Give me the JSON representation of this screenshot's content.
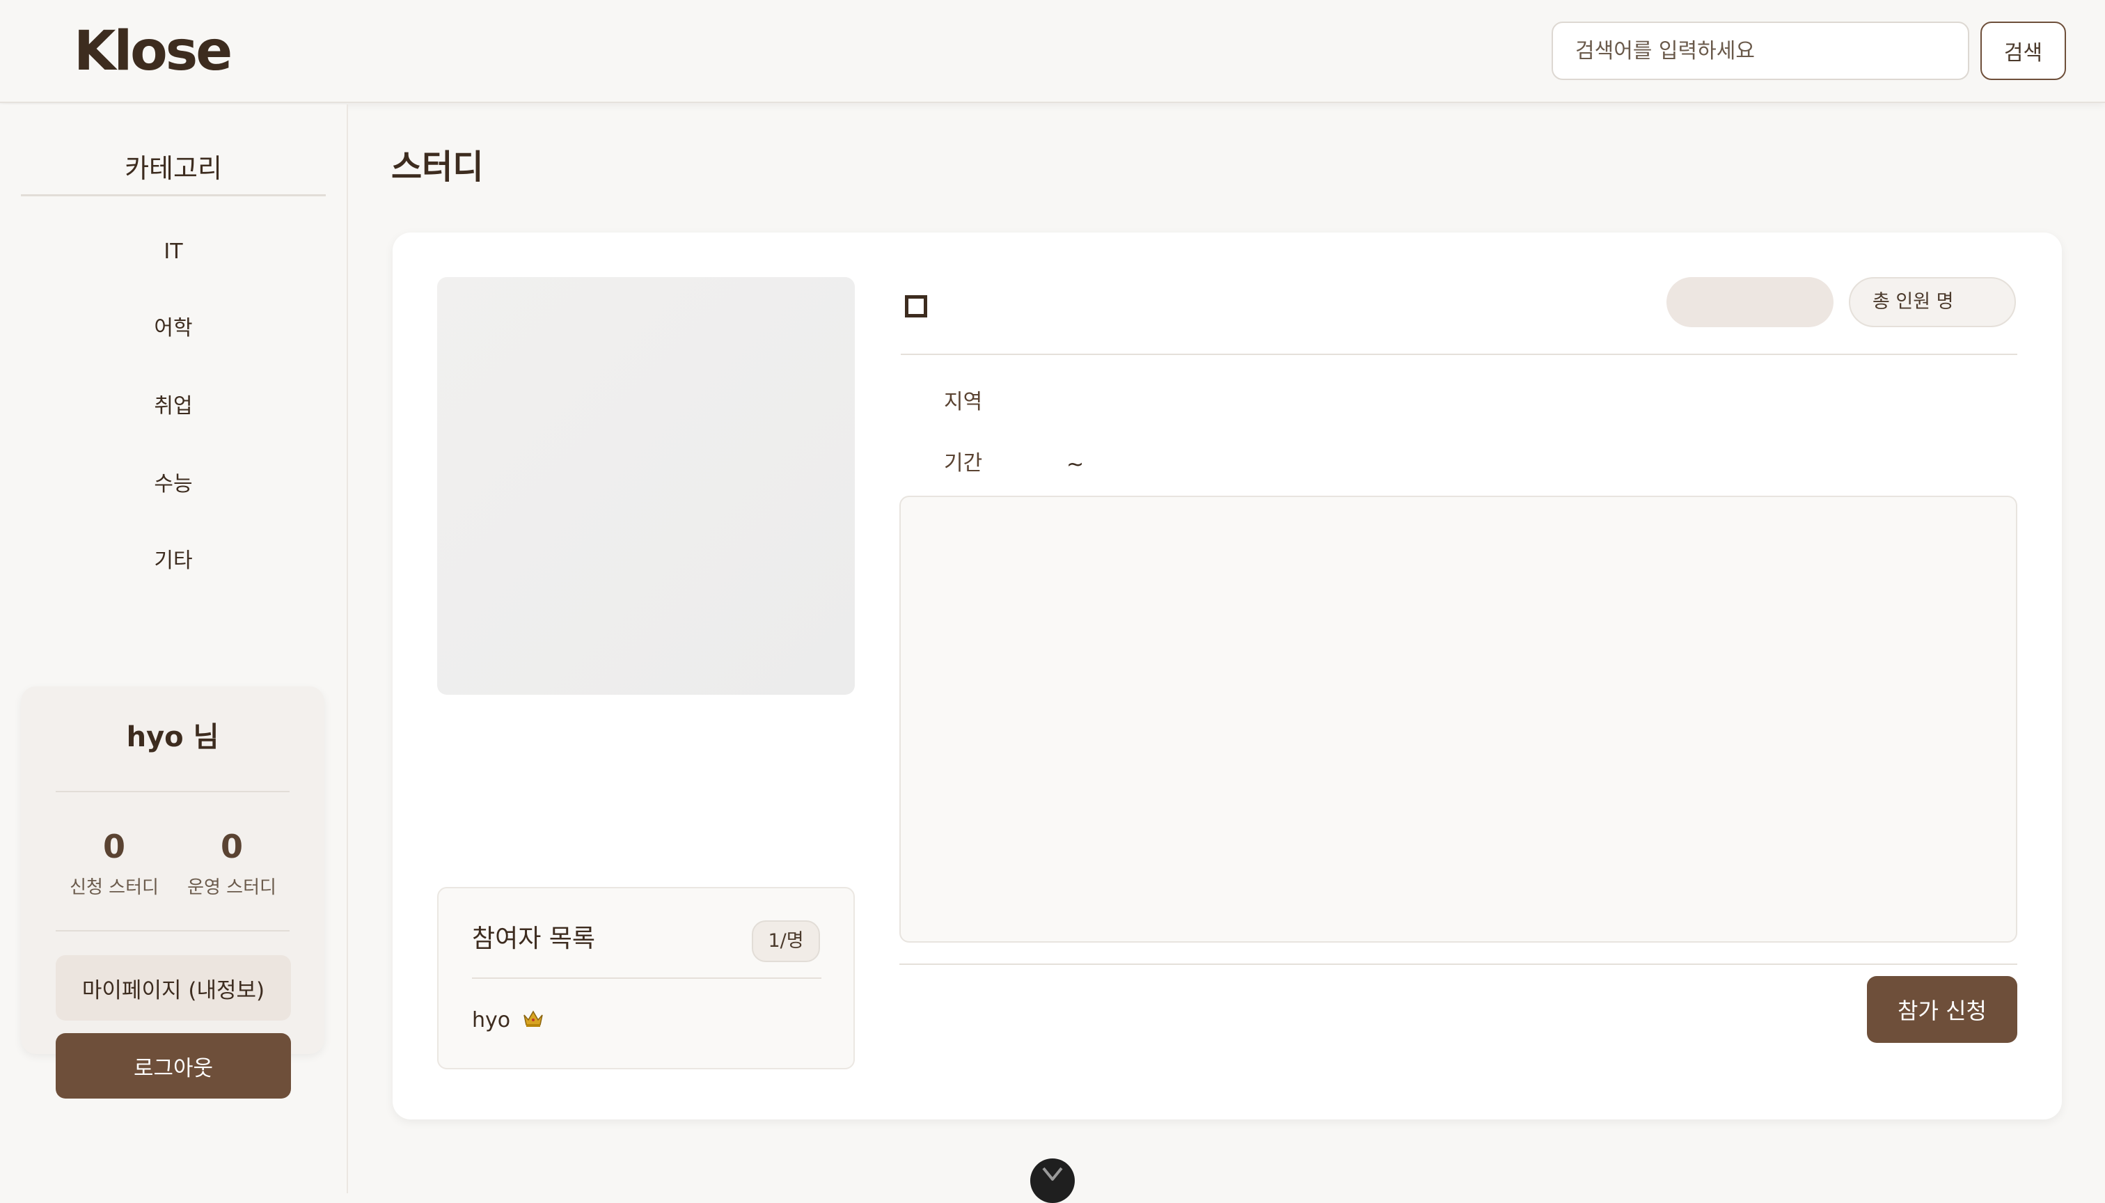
{
  "header": {
    "logo": "Klose",
    "search_placeholder": "검색어를 입력하세요",
    "search_button": "검색"
  },
  "sidebar": {
    "category_title": "카테고리",
    "categories": [
      {
        "label": "IT"
      },
      {
        "label": "어학"
      },
      {
        "label": "취업"
      },
      {
        "label": "수능"
      },
      {
        "label": "기타"
      }
    ],
    "user": {
      "name": "hyo 님",
      "applied_count": "0",
      "applied_label": "신청 스터디",
      "managed_count": "0",
      "managed_label": "운영 스터디",
      "mypage_button": "마이페이지 (내정보)",
      "logout_button": "로그아웃"
    }
  },
  "main": {
    "page_title": "스터디",
    "members_pill": "총 인원  명",
    "region_label": "지역",
    "period_label": "기간",
    "period_value": "~",
    "join_button": "참가 신청",
    "participants": {
      "title": "참여자 목록",
      "count": "1/명",
      "list": [
        {
          "name": "hyo",
          "icon": "crown-icon"
        }
      ]
    }
  },
  "colors": {
    "accent": "#6e4f3a",
    "background": "#f8f7f5",
    "text": "#3d2c1f"
  }
}
